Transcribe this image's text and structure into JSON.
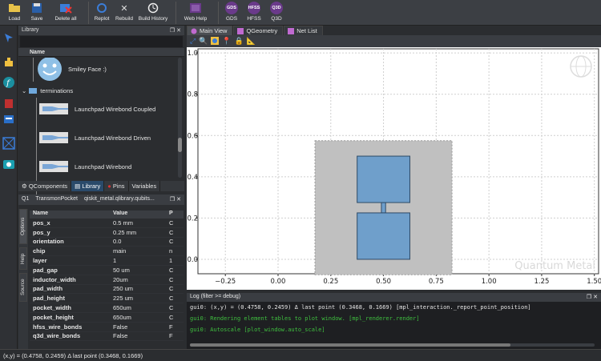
{
  "toolbar": {
    "buttons": [
      {
        "label": "Load",
        "icon": "load-icon"
      },
      {
        "label": "Save",
        "icon": "save-icon"
      },
      {
        "label": "Delete all",
        "icon": "delete-all-icon"
      },
      {
        "label": "Replot",
        "icon": "replot-icon"
      },
      {
        "label": "Rebuild",
        "icon": "rebuild-icon"
      },
      {
        "label": "Build History",
        "icon": "build-history-icon"
      },
      {
        "label": "Web Help",
        "icon": "web-help-icon"
      },
      {
        "label": "GDS",
        "icon_text": "GDS"
      },
      {
        "label": "HFSS",
        "icon_text": "HFSS"
      },
      {
        "label": "Q3D",
        "icon_text": "Q3D"
      }
    ]
  },
  "library": {
    "title": "Library",
    "column": "Name",
    "items": [
      {
        "label": "Smiley Face :)",
        "type": "smiley"
      },
      {
        "label": "terminations",
        "type": "folder"
      },
      {
        "label": "Launchpad Wirebond Coupled",
        "type": "launchpad"
      },
      {
        "label": "Launchpad Wirebond Driven",
        "type": "launchpad"
      },
      {
        "label": "Launchpad Wirebond",
        "type": "launchpad"
      }
    ],
    "tabs": [
      "QComponents",
      "Library",
      "Pins",
      "Variables"
    ]
  },
  "options": {
    "header_left": "Q1",
    "header_mid": "TransmonPocket",
    "header_right": "qiskit_metal.qlibrary.qubits...",
    "vtabs": [
      "Options",
      "Help",
      "Source"
    ],
    "columns": [
      "Name",
      "Value",
      "P"
    ],
    "rows": [
      {
        "name": "pos_x",
        "value": "0.5 mm",
        "p": "C"
      },
      {
        "name": "pos_y",
        "value": "0.25 mm",
        "p": "C"
      },
      {
        "name": "orientation",
        "value": "0.0",
        "p": "C"
      },
      {
        "name": "chip",
        "value": "main",
        "p": "n"
      },
      {
        "name": "layer",
        "value": "1",
        "p": "1"
      },
      {
        "name": "pad_gap",
        "value": "50 um",
        "p": "C"
      },
      {
        "name": "inductor_width",
        "value": "20um",
        "p": "C"
      },
      {
        "name": "pad_width",
        "value": "250 um",
        "p": "C"
      },
      {
        "name": "pad_height",
        "value": "225 um",
        "p": "C"
      },
      {
        "name": "pocket_width",
        "value": "650um",
        "p": "C"
      },
      {
        "name": "pocket_height",
        "value": "650um",
        "p": "C"
      },
      {
        "name": "hfss_wire_bonds",
        "value": "False",
        "p": "F"
      },
      {
        "name": "q3d_wire_bonds",
        "value": "False",
        "p": "F"
      }
    ]
  },
  "main_tabs": [
    "Main View",
    "QGeometry",
    "Net List"
  ],
  "plot": {
    "watermark": "Quantum Metal",
    "x_ticks": [
      "−0.25",
      "0.00",
      "0.25",
      "0.50",
      "0.75",
      "1.00",
      "1.25",
      "1.50"
    ],
    "y_ticks": [
      "0.0",
      "0.2",
      "0.4",
      "0.6",
      "0.8",
      "1.0"
    ],
    "xlim": [
      -0.38,
      1.52
    ],
    "ylim": [
      -0.07,
      1.02
    ],
    "pocket": {
      "x": [
        0.175,
        0.825
      ],
      "y": [
        -0.075,
        0.575
      ]
    },
    "pad_top": {
      "x": [
        0.375,
        0.625
      ],
      "y": [
        0.275,
        0.5
      ]
    },
    "pad_bottom": {
      "x": [
        0.375,
        0.625
      ],
      "y": [
        0.0,
        0.225
      ]
    },
    "junction": {
      "x": [
        0.49,
        0.51
      ],
      "y": [
        0.225,
        0.275
      ]
    },
    "colors": {
      "pocket": "#c0c0c0",
      "pad": "#6f9fcb",
      "pad_edge": "#2e4a66"
    }
  },
  "log": {
    "title": "Log",
    "filter": "(filter >= debug)",
    "lines": [
      {
        "text": "gui0: (x,y) = (0.4758, 0.2459)  Δ last point (0.3468, 0.1669) [mpl_interaction._report_point_position]",
        "color": "#e6e6e6"
      },
      {
        "text": "gui0: Rendering element tables to plot window. [mpl_renderer.render]",
        "color": "#3fbf3f"
      },
      {
        "text": "gui0: Autoscale [plot_window.auto_scale]",
        "color": "#3fbf3f"
      }
    ]
  },
  "status": "(x,y) = (0.4758, 0.2459)  Δ last point (0.3468, 0.1669)"
}
